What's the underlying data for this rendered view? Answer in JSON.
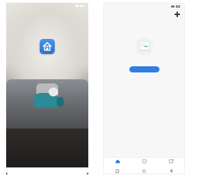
{
  "splash": {
    "status_time": "",
    "title": "",
    "subtitle": ""
  },
  "home": {
    "status_time": "",
    "home_name": "",
    "empty_caption": "",
    "add_device_label": "",
    "tabs": [
      {
        "label": "",
        "icon": "home-icon"
      },
      {
        "label": "",
        "icon": "scene-icon"
      },
      {
        "label": "",
        "icon": "profile-icon"
      }
    ]
  },
  "colors": {
    "accent": "#2f7de1",
    "logo": "#3d82da",
    "pet": "#2a8a96"
  }
}
